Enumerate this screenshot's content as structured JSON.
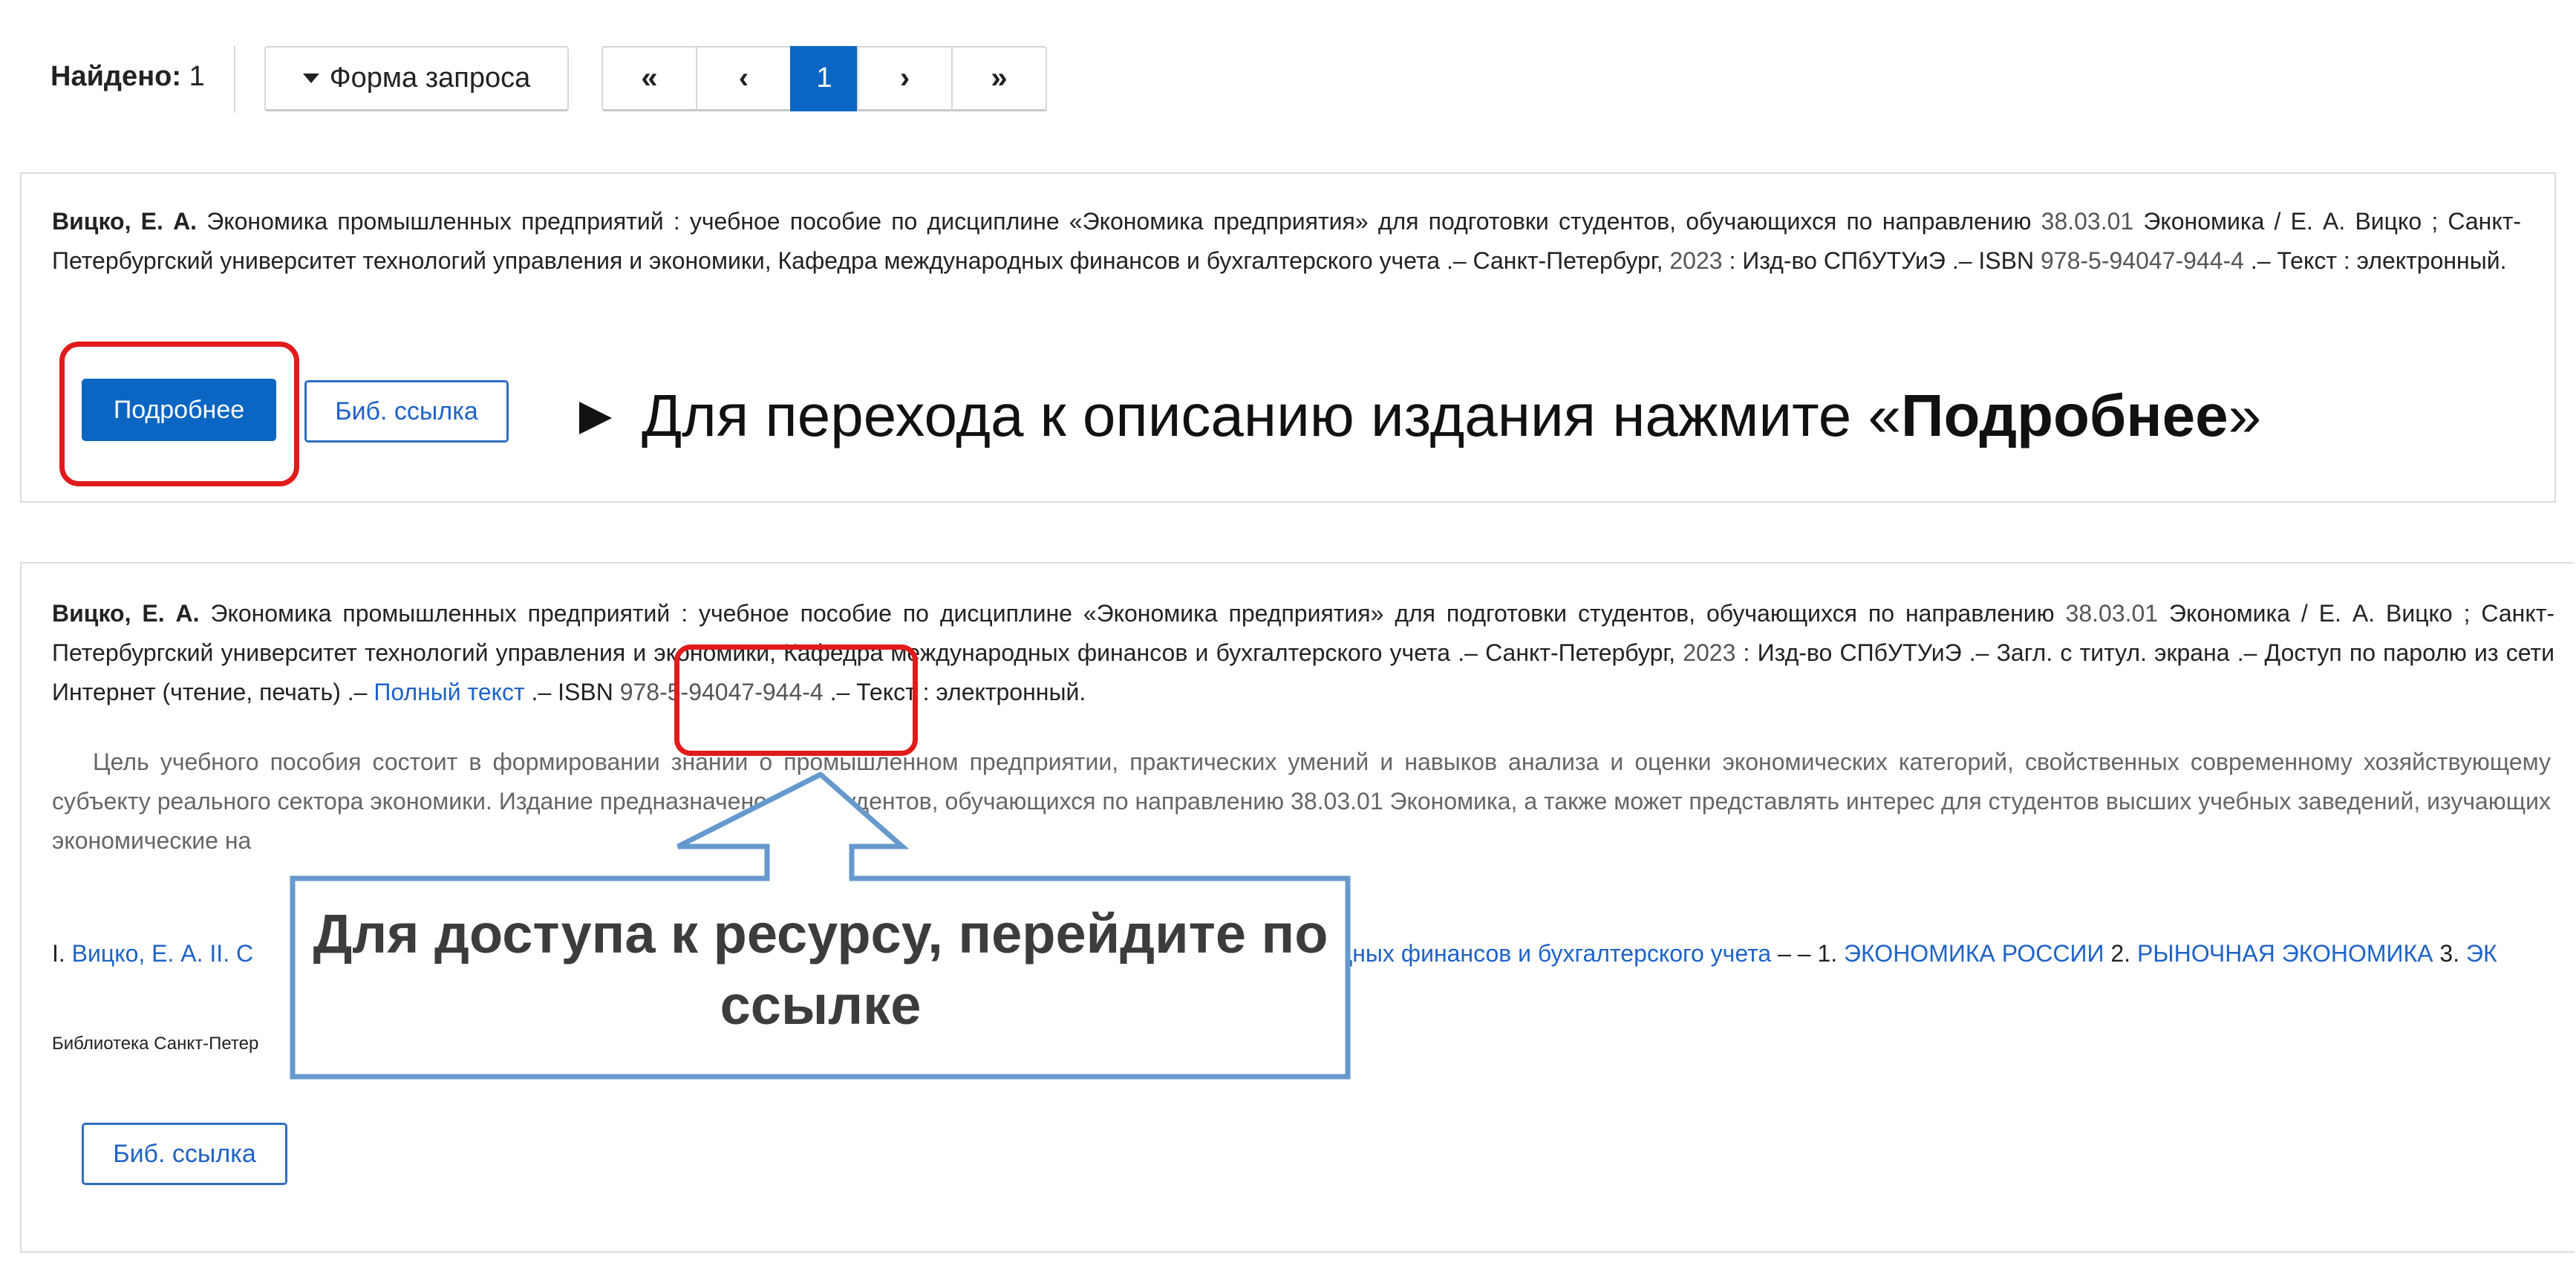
{
  "toolbar": {
    "found_label": "Найдено:",
    "found_count": "1",
    "form_button": "Форма запроса",
    "pager": {
      "first": "«",
      "prev": "‹",
      "current": "1",
      "next": "›",
      "last": "»"
    }
  },
  "record1": {
    "author": "Вицко, Е. А.",
    "text_a": " Экономика промышленных предприятий : учебное пособие по дисциплине «Экономика предприятия» для подготовки студентов, обучающихся по направлению ",
    "code": "38.03.01",
    "text_b": " Экономика / Е. А. Вицко ; Санкт-Петербургский университет технологий управления и экономики, Кафедра международных финансов и бухгалтерского учета .– Санкт-Петербург, ",
    "year": "2023",
    "text_c": " : Изд-во СПбУТУиЭ .– ISBN ",
    "isbn": "978-5-94047-944-4",
    "text_d": " .– Текст : электронный.",
    "more_button": "Подробнее",
    "bibref_button": "Биб. ссылка",
    "hint_prefix": "Для перехода к описанию издания нажмите «",
    "hint_bold": "Подробнее",
    "hint_suffix": "»"
  },
  "record2": {
    "author": "Вицко, Е. А.",
    "text_a": " Экономика промышленных предприятий : учебное пособие по дисциплине «Экономика предприятия» для подготовки студентов, обучающихся по направлению ",
    "code": "38.03.01",
    "text_b": " Экономика / Е. А. Вицко ; Санкт-Петербургский университет технологий управления и экономики, Кафедра международных финансов и бухгалтерского учета .– Санкт-Петербург, ",
    "year": "2023",
    "text_c": " : Изд-во СПбУТУиЭ .– Загл. с титул. экрана .– Доступ по паролю из сети Интернет (чтение, печать) .– ",
    "fulltext_link": "Полный текст",
    "text_d": " .– ISBN ",
    "isbn": "978-5-94047-944-4",
    "text_e": " .– Текст : электронный.",
    "annotation": "Цель учебного пособия состоит в формировании знаний о промышленном предприятии, практических умений и навыков анализа и оценки экономических категорий, свойственных современному хозяйствующему субъекту реального сектора экономики. Издание предназначено для студентов, обучающихся по направлению 38.03.01 Экономика, а также может представлять интерес для студентов высших учебных заведений, изучающих экономические на",
    "subj_prefix_1": "I. ",
    "subj_author": "Вицко, Е. А.",
    "subj_prefix_2": " II. С",
    "subj_org_tail": "ждународных финансов и бухгалтерского учета",
    "subj_dashes": " – – 1. ",
    "subj_1": "ЭКОНОМИКА РОССИИ",
    "subj_2_num": " 2. ",
    "subj_2": "РЫНОЧНАЯ ЭКОНОМИКА",
    "subj_3_num": " 3. ",
    "subj_3": "ЭК",
    "library": "Библиотека Санкт-Петер",
    "bibref_button": "Биб. ссылка"
  },
  "callout": {
    "line1": "Для доступа к ресурсу, перейдите по",
    "line2": "ссылке",
    "border_color": "#6699cc"
  },
  "colors": {
    "primary": "#0a66c2",
    "link": "#1f63c6",
    "highlight_red": "#e11b1b"
  }
}
